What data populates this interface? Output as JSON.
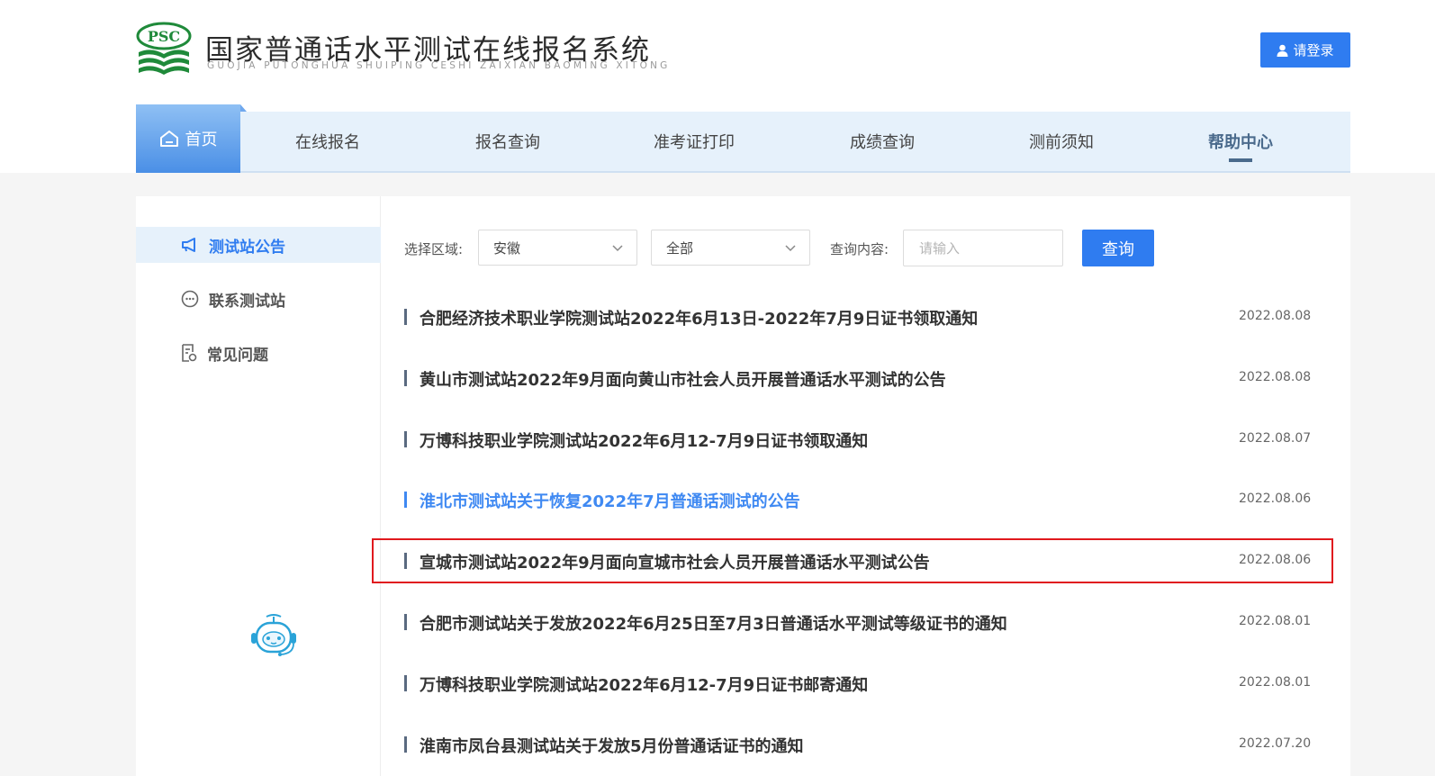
{
  "header": {
    "logo_text": "PSC",
    "title": "国家普通话水平测试在线报名系统",
    "subtitle": "GUOJIA PUTONGHUA SHUIPING CESHI ZAIXIAN BAOMING XITONG",
    "login_label": "请登录",
    "brand_color": "#2f7cf0"
  },
  "nav": {
    "home": "首页",
    "items": [
      "在线报名",
      "报名查询",
      "准考证打印",
      "成绩查询",
      "测前须知",
      "帮助中心"
    ],
    "active": "帮助中心"
  },
  "sidebar": {
    "items": [
      {
        "label": "测试站公告",
        "icon": "megaphone-icon",
        "active": true
      },
      {
        "label": "联系测试站",
        "icon": "chat-icon",
        "active": false
      },
      {
        "label": "常见问题",
        "icon": "faq-document-icon",
        "active": false
      }
    ],
    "assistant_icon": "robot-assistant-icon"
  },
  "filters": {
    "region_label": "选择区域:",
    "province_value": "安徽",
    "city_value": "全部",
    "query_label": "查询内容:",
    "query_placeholder": "请输入",
    "query_button": "查询"
  },
  "announcements": [
    {
      "title": "合肥经济技术职业学院测试站2022年6月13日-2022年7月9日证书领取通知",
      "date": "2022.08.08",
      "link": false
    },
    {
      "title": "黄山市测试站2022年9月面向黄山市社会人员开展普通话水平测试的公告",
      "date": "2022.08.08",
      "link": false
    },
    {
      "title": "万博科技职业学院测试站2022年6月12-7月9日证书领取通知",
      "date": "2022.08.07",
      "link": false
    },
    {
      "title": "淮北市测试站关于恢复2022年7月普通话测试的公告",
      "date": "2022.08.06",
      "link": true
    },
    {
      "title": "宣城市测试站2022年9月面向宣城市社会人员开展普通话水平测试公告",
      "date": "2022.08.06",
      "link": false,
      "highlighted": true
    },
    {
      "title": "合肥市测试站关于发放2022年6月25日至7月3日普通话水平测试等级证书的通知",
      "date": "2022.08.01",
      "link": false
    },
    {
      "title": "万博科技职业学院测试站2022年6月12-7月9日证书邮寄通知",
      "date": "2022.08.01",
      "link": false
    },
    {
      "title": "淮南市凤台县测试站关于发放5月份普通话证书的通知",
      "date": "2022.07.20",
      "link": false
    }
  ],
  "highlight_color": "#e0191e"
}
